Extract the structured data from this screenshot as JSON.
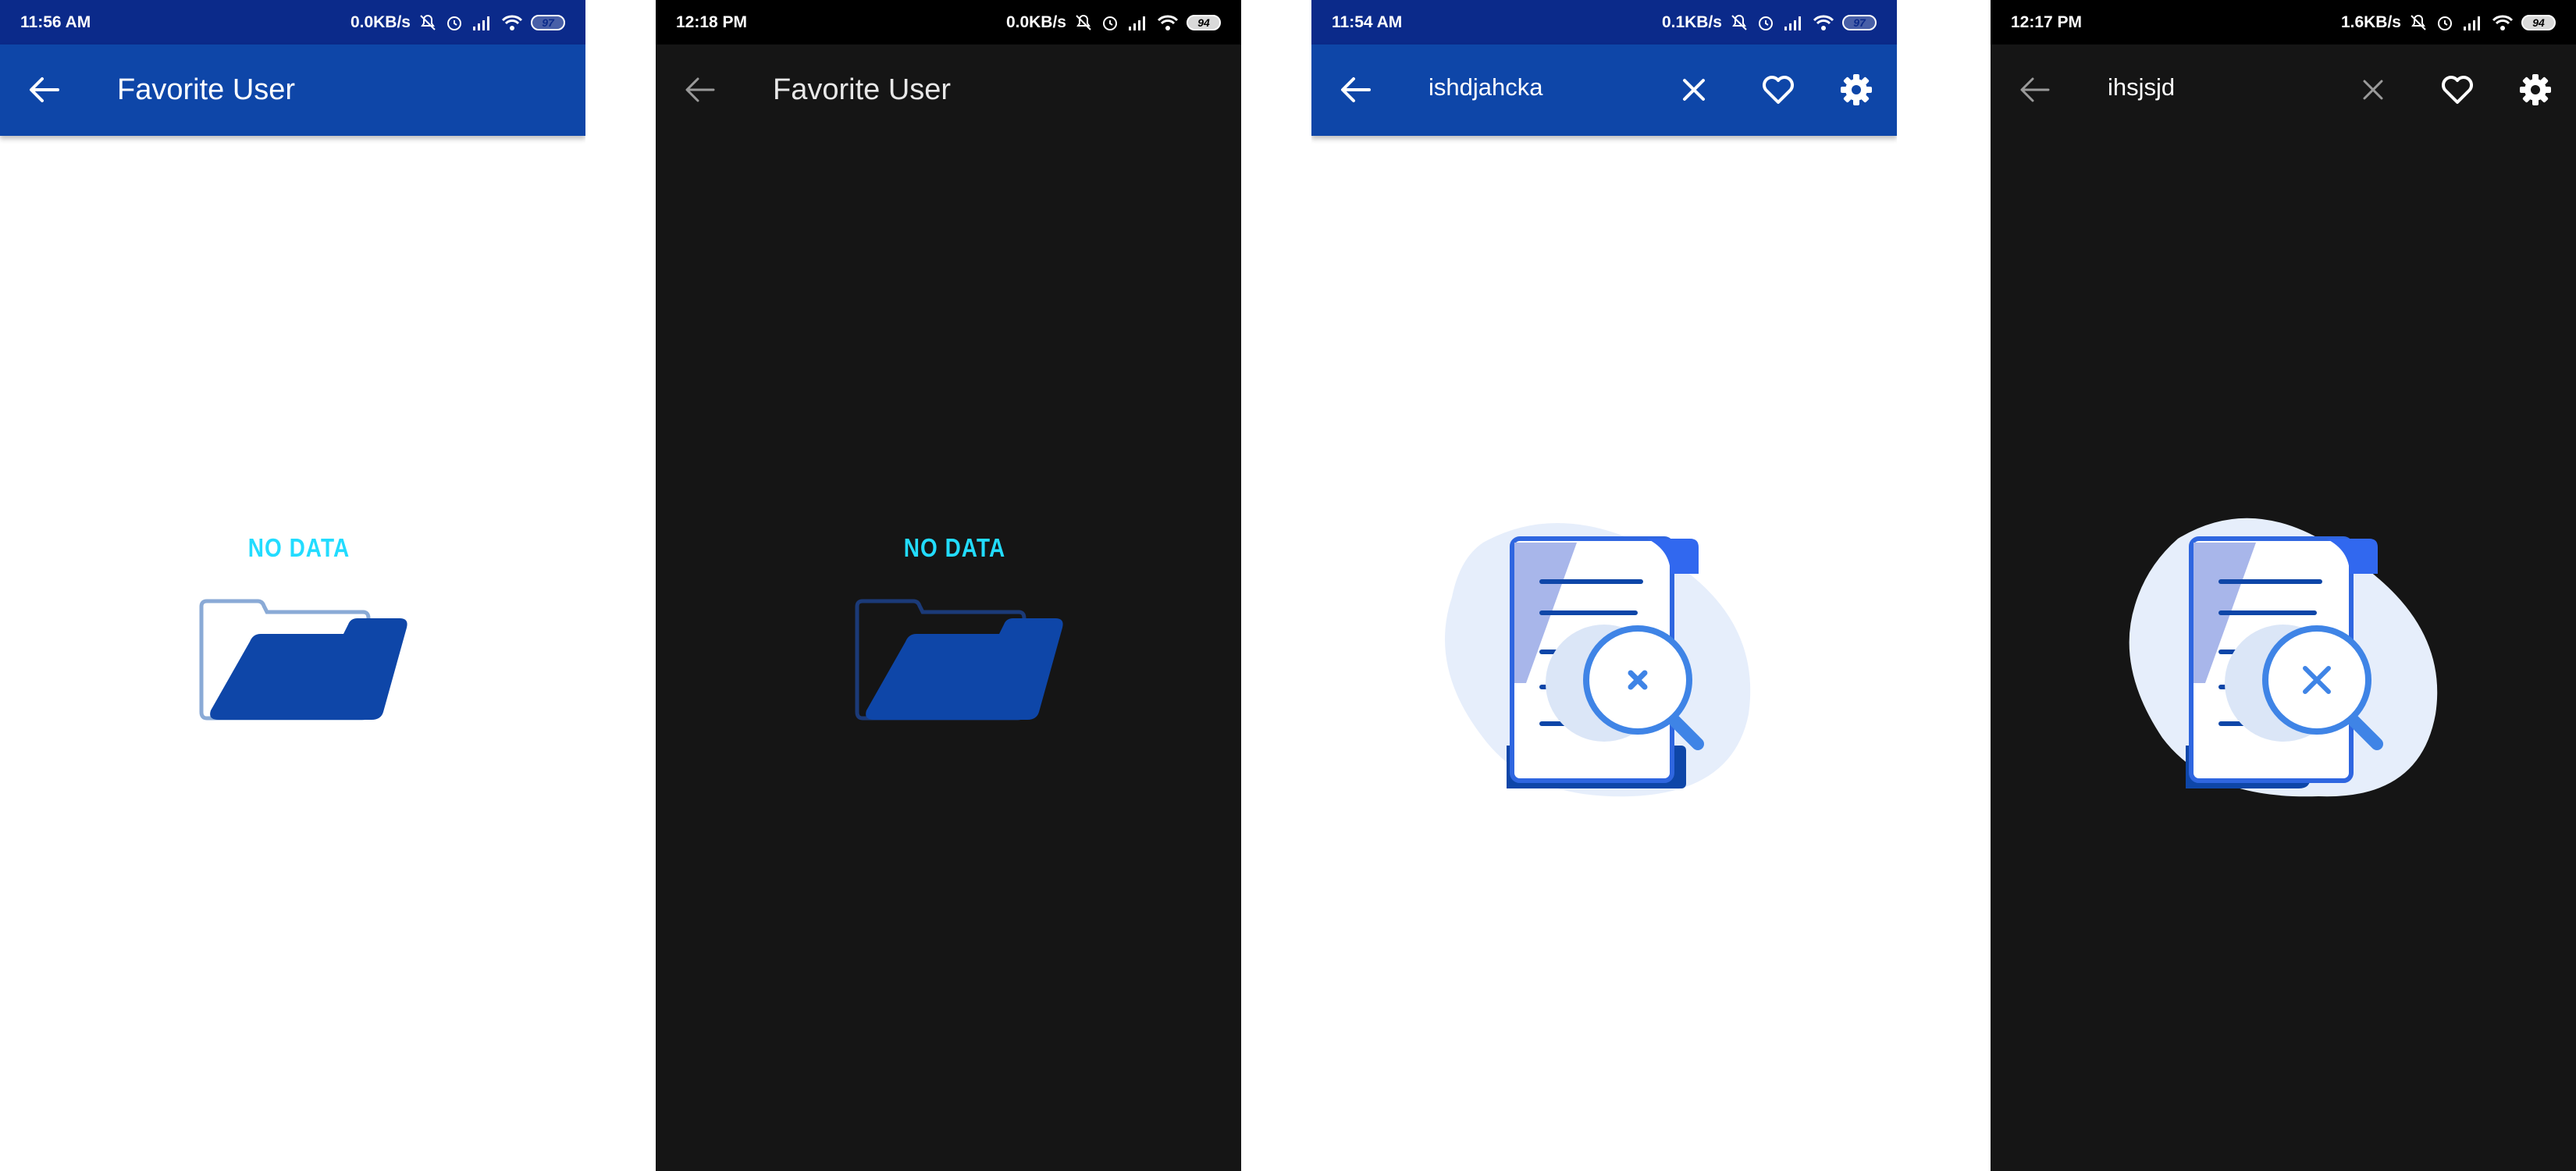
{
  "screens": [
    {
      "theme": "light",
      "status": {
        "time": "11:56 AM",
        "speed": "0.0KB/s",
        "battery": "97"
      },
      "appbar": {
        "title": "Favorite User"
      },
      "empty": {
        "label": "NO DATA",
        "icon": "folder-icon"
      }
    },
    {
      "theme": "dark",
      "status": {
        "time": "12:18 PM",
        "speed": "0.0KB/s",
        "battery": "94"
      },
      "appbar": {
        "title": "Favorite User"
      },
      "empty": {
        "label": "NO DATA",
        "icon": "folder-icon"
      }
    },
    {
      "theme": "light",
      "status": {
        "time": "11:54 AM",
        "speed": "0.1KB/s",
        "battery": "97"
      },
      "appbar": {
        "search_query": "ishdjahcka",
        "actions": [
          "close-icon",
          "heart-icon",
          "gear-icon"
        ]
      },
      "empty": {
        "icon": "document-search-not-found-icon"
      }
    },
    {
      "theme": "dark",
      "status": {
        "time": "12:17 PM",
        "speed": "1.6KB/s",
        "battery": "94"
      },
      "appbar": {
        "search_query": "ihsjsjd",
        "actions": [
          "close-icon",
          "heart-icon",
          "gear-icon"
        ]
      },
      "empty": {
        "icon": "document-search-not-found-icon"
      }
    }
  ],
  "colors": {
    "light_statusbar": "#0b2a8a",
    "light_appbar": "#0e46a8",
    "dark_background": "#151515",
    "accent_label": "#22dcff",
    "folder_blue": "#0e46a8"
  }
}
